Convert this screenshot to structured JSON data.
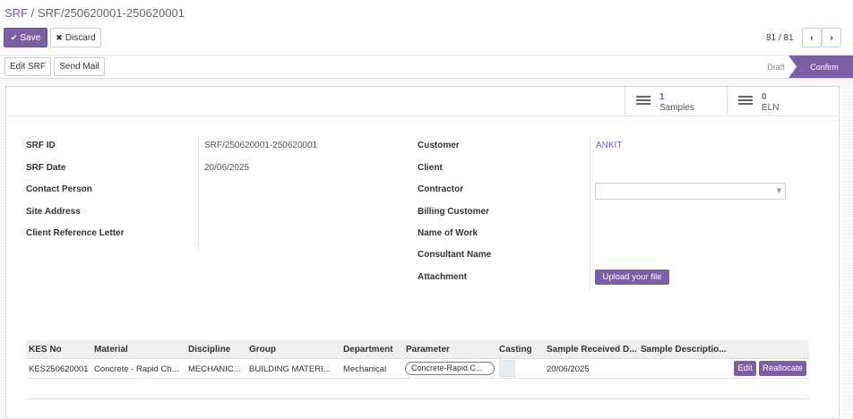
{
  "breadcrumb": {
    "root": "SRF",
    "separator": " / ",
    "current": "SRF/250620001-250620001"
  },
  "actions": {
    "save": "Save",
    "discard": "Discard"
  },
  "pager": {
    "value": "81 / 81",
    "prev": "‹",
    "next": "›"
  },
  "header_buttons": {
    "edit_srf": "Edit SRF",
    "send_mail": "Send Mail"
  },
  "status": {
    "draft": "Draft",
    "confirm": "Confirm"
  },
  "smart_buttons": {
    "samples": {
      "count": "1",
      "label": "Samples"
    },
    "eln": {
      "count": "0",
      "label": "ELN"
    }
  },
  "left_fields": [
    {
      "label": "SRF ID",
      "value": "SRF/250620001-250620001"
    },
    {
      "label": "SRF Date",
      "value": "20/06/2025"
    },
    {
      "label": "Contact Person",
      "value": ""
    },
    {
      "label": "Site Address",
      "value": ""
    },
    {
      "label": "Client Reference Letter",
      "value": ""
    }
  ],
  "right_fields": [
    {
      "label": "Customer",
      "value": "ANKIT"
    },
    {
      "label": "Client",
      "value": ""
    },
    {
      "label": "Contractor",
      "value": ""
    },
    {
      "label": "Billing Customer",
      "value": ""
    },
    {
      "label": "Name of Work",
      "value": ""
    },
    {
      "label": "Consultant Name",
      "value": ""
    },
    {
      "label": "Attachment",
      "value": ""
    }
  ],
  "upload_label": "Upload your file",
  "grid": {
    "columns": [
      "KES No",
      "Material",
      "Discipline",
      "Group",
      "Department",
      "Parameter",
      "Casting",
      "Sample Received D...",
      "Sample Descriptio..."
    ],
    "rows": [
      {
        "kes_no": "KES250620001",
        "material": "Concrete - Rapid Ch...",
        "discipline": "MECHANIC...",
        "group": "BUILDING MATERI...",
        "department": "Mechanical",
        "parameter": "Concrete-Rapid C...",
        "casting": "",
        "received": "20/06/2025",
        "description": "",
        "edit": "Edit",
        "reallocate": "Reallocate"
      }
    ]
  },
  "colors": {
    "primary": "#7c5fa5"
  }
}
